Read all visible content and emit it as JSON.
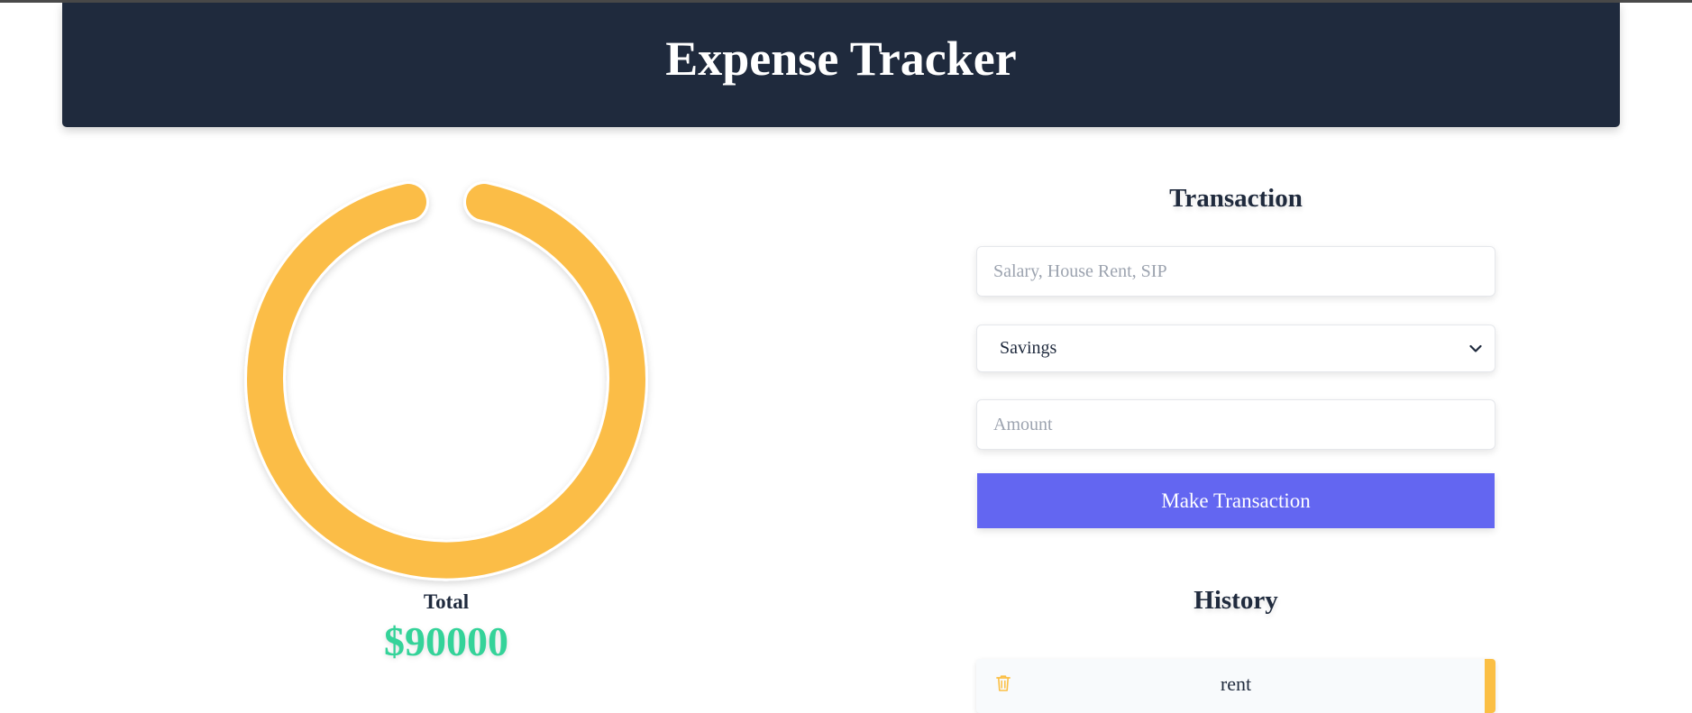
{
  "header": {
    "title": "Expense Tracker"
  },
  "summary": {
    "total_label": "Total",
    "total_value": "$90000",
    "chart_color": "#fbbd47",
    "value_color": "#34d399"
  },
  "transaction": {
    "title": "Transaction",
    "name_placeholder": "Salary, House Rent, SIP",
    "name_value": "",
    "type_selected": "Savings",
    "amount_placeholder": "Amount",
    "amount_value": "",
    "submit_label": "Make Transaction",
    "submit_color": "#6366f1"
  },
  "history": {
    "title": "History",
    "items": [
      {
        "name": "rent",
        "delete_icon": "trash-icon",
        "accent": "#fbbf44"
      }
    ]
  }
}
